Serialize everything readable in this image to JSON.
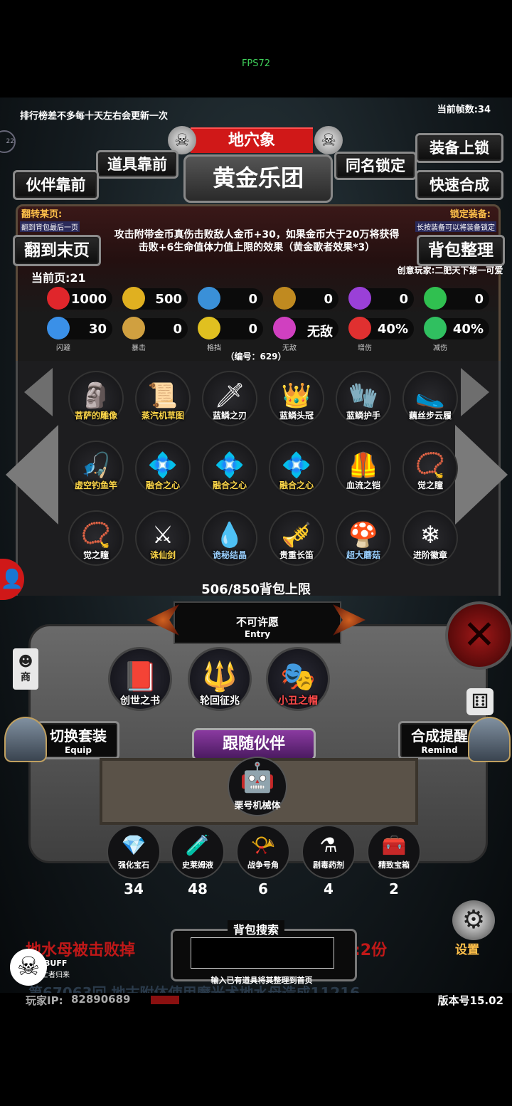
{
  "fps_label": "FPS72",
  "ticker": "排行榜差不多每十天左右会更新一次",
  "frame_rate_label": "当前帧数:34",
  "header": {
    "area_name": "地穴象",
    "set_name": "黄金乐团",
    "btn_item_front": "道具靠前",
    "btn_companion_front": "伙伴靠前",
    "btn_same_name_lock": "同名锁定",
    "btn_equip_lock": "装备上锁",
    "btn_quick_synth": "快速合成"
  },
  "left_info": {
    "title": "翻转某页:",
    "hint": "翻到背包最后一页"
  },
  "right_info": {
    "title": "锁定装备:",
    "hint": "长按装备可以将装备锁定"
  },
  "set_effect": "攻击附带金币真伤击败敌人金币+30，如果金币大于20万将获得击败+6生命值体力值上限的效果（黄金歌者效果*3）",
  "btn_last_page": "翻到末页",
  "btn_sort_bag": "背包整理",
  "current_page": "当前页:21",
  "creator": "创意玩家:二肥天下第一可爱",
  "stats_row1": [
    {
      "icon": "heart-icon",
      "value": "1000",
      "color": "#e0262b"
    },
    {
      "icon": "strength-icon",
      "value": "500",
      "color": "#e0b020"
    },
    {
      "icon": "helmet-icon",
      "value": "0",
      "color": "#3a90d8"
    },
    {
      "icon": "bow-icon",
      "value": "0",
      "color": "#c08a20"
    },
    {
      "icon": "lightning-icon",
      "value": "0",
      "color": "#9a40d8"
    },
    {
      "icon": "clover-icon",
      "value": "0",
      "color": "#30c050"
    }
  ],
  "stats_row2": [
    {
      "icon": "boot-icon",
      "value": "30",
      "label": "闪避",
      "color": "#3a90e8"
    },
    {
      "icon": "crit-icon",
      "value": "0",
      "label": "暴击",
      "color": "#d0a040"
    },
    {
      "icon": "shield-icon",
      "value": "0",
      "label": "格挡",
      "color": "#e0c020"
    },
    {
      "icon": "wings-icon",
      "value": "无敌",
      "label": "无敌",
      "color": "#d040c0"
    },
    {
      "icon": "swords-icon",
      "value": "40%",
      "label": "增伤",
      "color": "#e03030"
    },
    {
      "icon": "defense-icon",
      "value": "40%",
      "label": "减伤",
      "color": "#30c060"
    }
  ],
  "serial": "（编号：629）",
  "items": [
    {
      "name": "菩萨的雕像",
      "icon": "statue-icon",
      "glyph": "🗿",
      "color": "#ffd84a"
    },
    {
      "name": "蒸汽机草图",
      "icon": "scroll-icon",
      "glyph": "📜",
      "color": "#ffd84a"
    },
    {
      "name": "蓝鳞之刃",
      "icon": "blade-icon",
      "glyph": "🗡",
      "color": "#ffffff"
    },
    {
      "name": "蓝鳞头冠",
      "icon": "crown-icon",
      "glyph": "👑",
      "color": "#ffffff"
    },
    {
      "name": "蓝鳞护手",
      "icon": "gauntlet-icon",
      "glyph": "🧤",
      "color": "#ffffff"
    },
    {
      "name": "藕丝步云履",
      "icon": "shoes-icon",
      "glyph": "🥿",
      "color": "#ffffff"
    },
    {
      "name": "虚空钓鱼竿",
      "icon": "fishing-rod-icon",
      "glyph": "🎣",
      "color": "#ffd84a"
    },
    {
      "name": "融合之心",
      "icon": "fusion-heart-icon",
      "glyph": "💠",
      "color": "#ffd84a"
    },
    {
      "name": "融合之心",
      "icon": "fusion-heart-icon",
      "glyph": "💠",
      "color": "#ffd84a"
    },
    {
      "name": "融合之心",
      "icon": "fusion-heart-icon",
      "glyph": "💠",
      "color": "#ffd84a"
    },
    {
      "name": "血流之铠",
      "icon": "armor-icon",
      "glyph": "🦺",
      "color": "#ffffff"
    },
    {
      "name": "觉之瞳",
      "icon": "eye-amulet-icon",
      "glyph": "📿",
      "color": "#ffffff"
    },
    {
      "name": "觉之瞳",
      "icon": "eye-amulet-icon",
      "glyph": "📿",
      "color": "#ffffff"
    },
    {
      "name": "诛仙剑",
      "icon": "sword-icon",
      "glyph": "⚔",
      "color": "#ffd84a"
    },
    {
      "name": "诡秘结晶",
      "icon": "crystal-icon",
      "glyph": "💧",
      "color": "#9ad0ff"
    },
    {
      "name": "贵重长笛",
      "icon": "flute-icon",
      "glyph": "🎺",
      "color": "#ffffff"
    },
    {
      "name": "超大蘑菇",
      "icon": "mushroom-icon",
      "glyph": "🍄",
      "color": "#9ad0ff"
    },
    {
      "name": "进阶徽章",
      "icon": "badge-icon",
      "glyph": "❄",
      "color": "#ffffff"
    }
  ],
  "bag_limit": "506/850背包上限",
  "wish": {
    "title": "不可许愿",
    "sub": "Entry"
  },
  "featured": [
    {
      "name": "创世之书",
      "icon": "book-icon",
      "glyph": "📕",
      "color": "#ffffff"
    },
    {
      "name": "轮回征兆",
      "icon": "staff-icon",
      "glyph": "🔱",
      "color": "#ffffff"
    },
    {
      "name": "小丑之帽",
      "icon": "jester-hat-icon",
      "glyph": "🎭",
      "color": "#ff4a4a"
    }
  ],
  "btn_switch_set": {
    "label": "切换套装",
    "sub": "Equip"
  },
  "btn_synth_reminder": {
    "label": "合成提醒",
    "sub": "Remind"
  },
  "follow_companion": "跟随伙伴",
  "companion": {
    "name": "栗号机械体",
    "glyph": "🤖"
  },
  "consumables": [
    {
      "name": "强化宝石",
      "icon": "gem-icon",
      "glyph": "💎",
      "count": "34"
    },
    {
      "name": "史莱姆液",
      "icon": "potion-icon",
      "glyph": "🧪",
      "count": "48"
    },
    {
      "name": "战争号角",
      "icon": "horn-icon",
      "glyph": "📯",
      "count": "6"
    },
    {
      "name": "剧毒药剂",
      "icon": "poison-icon",
      "glyph": "⚗",
      "count": "4"
    },
    {
      "name": "精致宝箱",
      "icon": "chest-icon",
      "glyph": "🧰",
      "count": "2"
    }
  ],
  "search": {
    "title": "背包搜索",
    "hint": "输入已有道具将其整理到首页",
    "value": ""
  },
  "side": {
    "shop": "商",
    "settings": "设置"
  },
  "buff": {
    "label": "BUFF",
    "sub": "亡者归来"
  },
  "news1": "地水母被击败掉",
  "news1_tail": ":2份",
  "news2": "第67063回 地古附体使用魔光术地水母造成11216",
  "player_ip_label": "玩家IP:",
  "player_ip": "82890689",
  "version": "版本号15.02"
}
